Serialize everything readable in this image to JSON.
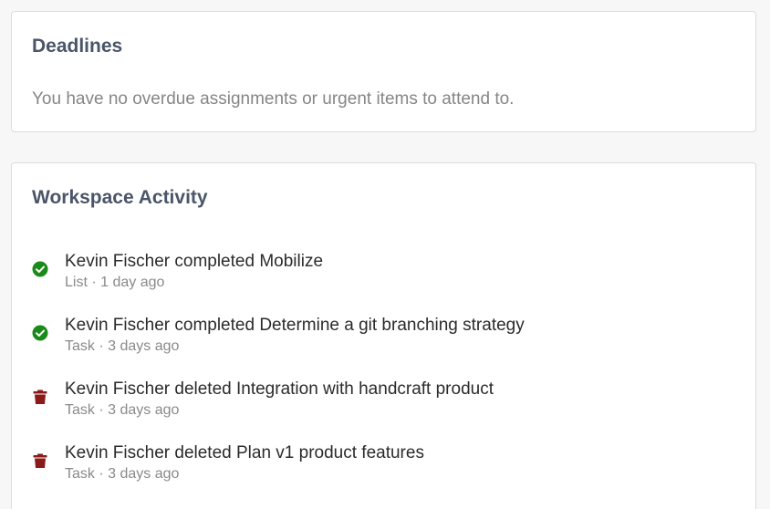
{
  "deadlines": {
    "title": "Deadlines",
    "empty_message": "You have no overdue assignments or urgent items to attend to."
  },
  "activity": {
    "title": "Workspace Activity",
    "items": [
      {
        "icon": "check-circle-icon",
        "icon_color": "#1a8a1a",
        "text": "Kevin Fischer completed Mobilize",
        "meta": "List · 1 day ago"
      },
      {
        "icon": "check-circle-icon",
        "icon_color": "#1a8a1a",
        "text": "Kevin Fischer completed Determine a git branching strategy",
        "meta": "Task · 3 days ago"
      },
      {
        "icon": "trash-icon",
        "icon_color": "#8b1a1a",
        "text": "Kevin Fischer deleted Integration with handcraft product",
        "meta": "Task · 3 days ago"
      },
      {
        "icon": "trash-icon",
        "icon_color": "#8b1a1a",
        "text": "Kevin Fischer deleted Plan v1 product features",
        "meta": "Task · 3 days ago"
      }
    ]
  }
}
